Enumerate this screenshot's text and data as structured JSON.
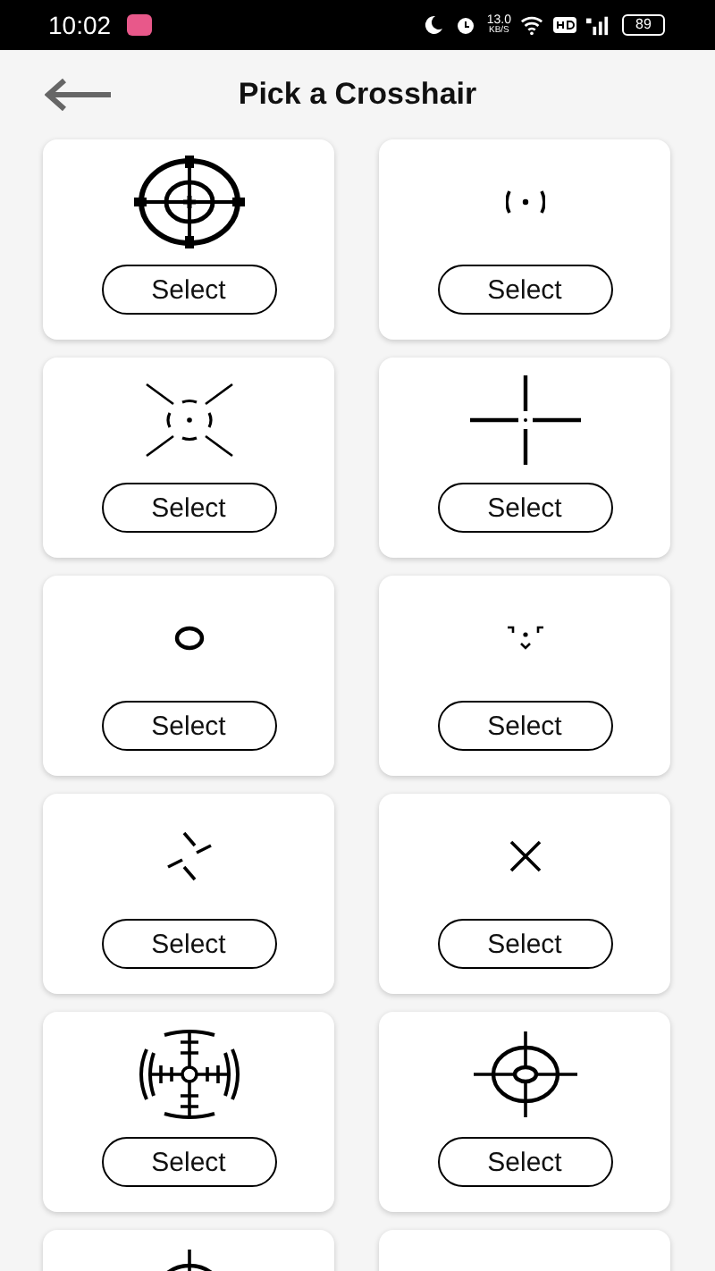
{
  "status_bar": {
    "time": "10:02",
    "speed": "13.0",
    "speed_unit": "KB/S",
    "battery": "89"
  },
  "header": {
    "title": "Pick a Crosshair"
  },
  "crosshairs": [
    {
      "kind": "scope",
      "button": "Select"
    },
    {
      "kind": "bracket-dot",
      "button": "Select"
    },
    {
      "kind": "x-ring",
      "button": "Select"
    },
    {
      "kind": "gap-cross",
      "button": "Select"
    },
    {
      "kind": "circle",
      "button": "Select"
    },
    {
      "kind": "chevron-dot",
      "button": "Select"
    },
    {
      "kind": "pinwheel",
      "button": "Select"
    },
    {
      "kind": "x",
      "button": "Select"
    },
    {
      "kind": "ranged-scope",
      "button": "Select"
    },
    {
      "kind": "target",
      "button": "Select"
    },
    {
      "kind": "ring-cross"
    },
    {
      "kind": "none"
    }
  ]
}
